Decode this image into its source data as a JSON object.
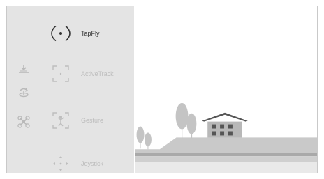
{
  "modes": [
    {
      "label": "TapFly",
      "active": true,
      "icon": "tapfly-icon"
    },
    {
      "label": "ActiveTrack",
      "active": false,
      "icon": "activetrack-icon"
    },
    {
      "label": "Gesture",
      "active": false,
      "icon": "gesture-icon"
    },
    {
      "label": "Joystick",
      "active": false,
      "icon": "joystick-icon"
    }
  ],
  "side_icons": [
    "landing-icon",
    "return-home-icon",
    "drone-icon"
  ],
  "colors": {
    "panel_bg": "#e4e4e4",
    "active_text": "#333333",
    "inactive_text": "#bdbdbd",
    "scene_gray": "#b5b5b5",
    "house_roof": "#555555"
  }
}
